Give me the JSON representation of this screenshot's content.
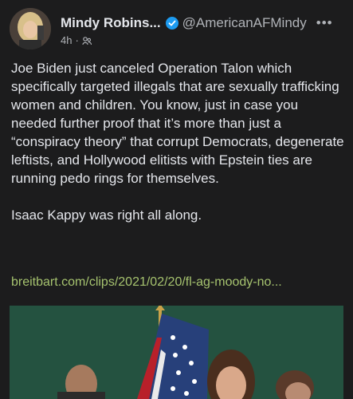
{
  "post": {
    "author_name": "Mindy Robins...",
    "handle": "@AmericanAFMindy",
    "more_label": "•••",
    "time": "4h",
    "separator": "·",
    "paragraphs": [
      "Joe Biden just canceled Operation Talon which specifically targeted illegals that are sexually trafficking women and children. You know, just in case you needed further proof that it’s more than just a “conspiracy theory” that corrupt Democrats, degenerate leftists, and Hollywood elitists with Epstein ties are running pedo rings for themselves.",
      "Isaac Kappy was right all along."
    ],
    "link": "breitbart.com/clips/2021/02/20/fl-ag-moody-no..."
  },
  "colors": {
    "background": "#1c1c1d",
    "text": "#e4e6eb",
    "muted": "#b0b3b8",
    "link": "#a6c36f",
    "verified": "#1d9bf0"
  },
  "icons": {
    "verified": "verified-badge-icon",
    "audience": "audience-icon",
    "more": "more-icon"
  }
}
